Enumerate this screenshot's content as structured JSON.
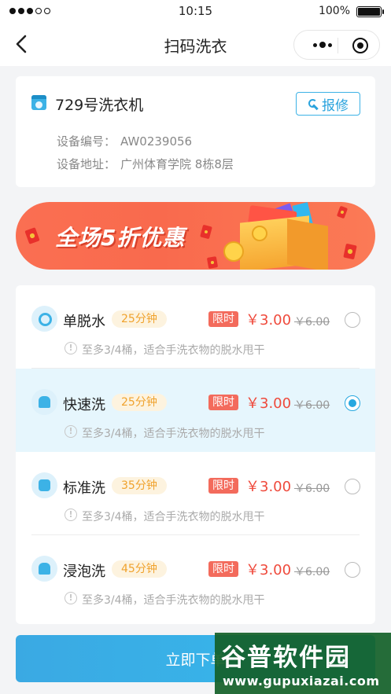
{
  "status_bar": {
    "time": "10:15",
    "battery_percent": "100%",
    "battery_level": 1.0,
    "signal_bars_filled": 3,
    "signal_bars_total": 5
  },
  "nav": {
    "title": "扫码洗衣"
  },
  "device": {
    "name": "729号洗衣机",
    "report_label": "报修",
    "code_label": "设备编号：",
    "code_value": "AW0239056",
    "address_label": "设备地址：",
    "address_value": "广州体育学院 8栋8层"
  },
  "banner": {
    "text": "全场5折优惠"
  },
  "modes": [
    {
      "icon": "spin-dry-icon",
      "name": "单脱水",
      "duration": "25分钟",
      "badge": "限时",
      "price": "￥3.00",
      "original_price": "￥6.00",
      "tip": "至多3/4桶，适合手洗衣物的脱水甩干",
      "selected": false
    },
    {
      "icon": "quick-wash-icon",
      "name": "快速洗",
      "duration": "25分钟",
      "badge": "限时",
      "price": "￥3.00",
      "original_price": "￥6.00",
      "tip": "至多3/4桶，适合手洗衣物的脱水甩干",
      "selected": true
    },
    {
      "icon": "standard-wash-icon",
      "name": "标准洗",
      "duration": "35分钟",
      "badge": "限时",
      "price": "￥3.00",
      "original_price": "￥6.00",
      "tip": "至多3/4桶，适合手洗衣物的脱水甩干",
      "selected": false
    },
    {
      "icon": "soak-wash-icon",
      "name": "浸泡洗",
      "duration": "45分钟",
      "badge": "限时",
      "price": "￥3.00",
      "original_price": "￥6.00",
      "tip": "至多3/4桶，适合手洗衣物的脱水甩干",
      "selected": false
    }
  ],
  "footer": {
    "confirm_label": "立即下单"
  },
  "watermark": {
    "logo": "谷普软件园",
    "url": "www.gupuxiazai.com"
  },
  "colors": {
    "accent": "#27a8e0",
    "price": "#ef4a3c",
    "badge": "#f36b5c",
    "duration_text": "#f0a22c",
    "selected_row": "#e6f6fd"
  }
}
